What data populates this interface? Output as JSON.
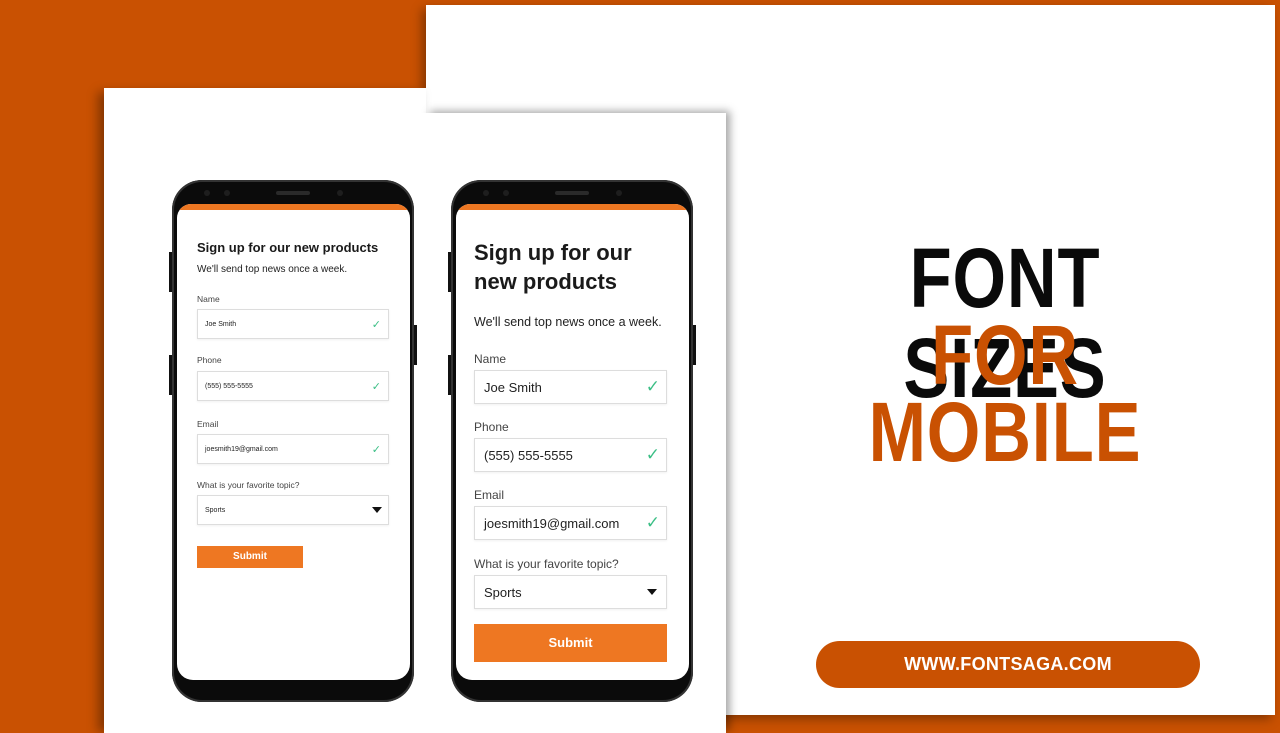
{
  "colors": {
    "background_orange": "#c95102",
    "form_accent": "#ee7722",
    "check_green": "#3cbf86",
    "headline_black": "#0a0a0a"
  },
  "headline": {
    "line1": "FONT SIZES",
    "line2": "FOR",
    "line3": "MOBILE"
  },
  "website": "WWW.FONTSAGA.COM",
  "phones": [
    {
      "variant": "small-font",
      "form": {
        "title": "Sign up for our new products",
        "subtitle": "We'll send top news once a week.",
        "fields": [
          {
            "label": "Name",
            "value": "Joe Smith",
            "icon": "check-icon"
          },
          {
            "label": "Phone",
            "value": "(555) 555-5555",
            "icon": "check-icon"
          },
          {
            "label": "Email",
            "value": "joesmith19@gmail.com",
            "icon": "check-icon"
          }
        ],
        "select": {
          "label": "What is your favorite topic?",
          "value": "Sports",
          "icon": "caret-down-icon"
        },
        "submit_label": "Submit"
      }
    },
    {
      "variant": "large-font",
      "form": {
        "title": "Sign up for our new products",
        "subtitle": "We'll send top news once a week.",
        "fields": [
          {
            "label": "Name",
            "value": "Joe Smith",
            "icon": "check-icon"
          },
          {
            "label": "Phone",
            "value": "(555) 555-5555",
            "icon": "check-icon"
          },
          {
            "label": "Email",
            "value": "joesmith19@gmail.com",
            "icon": "check-icon"
          }
        ],
        "select": {
          "label": "What is your favorite topic?",
          "value": "Sports",
          "icon": "caret-down-icon"
        },
        "submit_label": "Submit"
      }
    }
  ]
}
